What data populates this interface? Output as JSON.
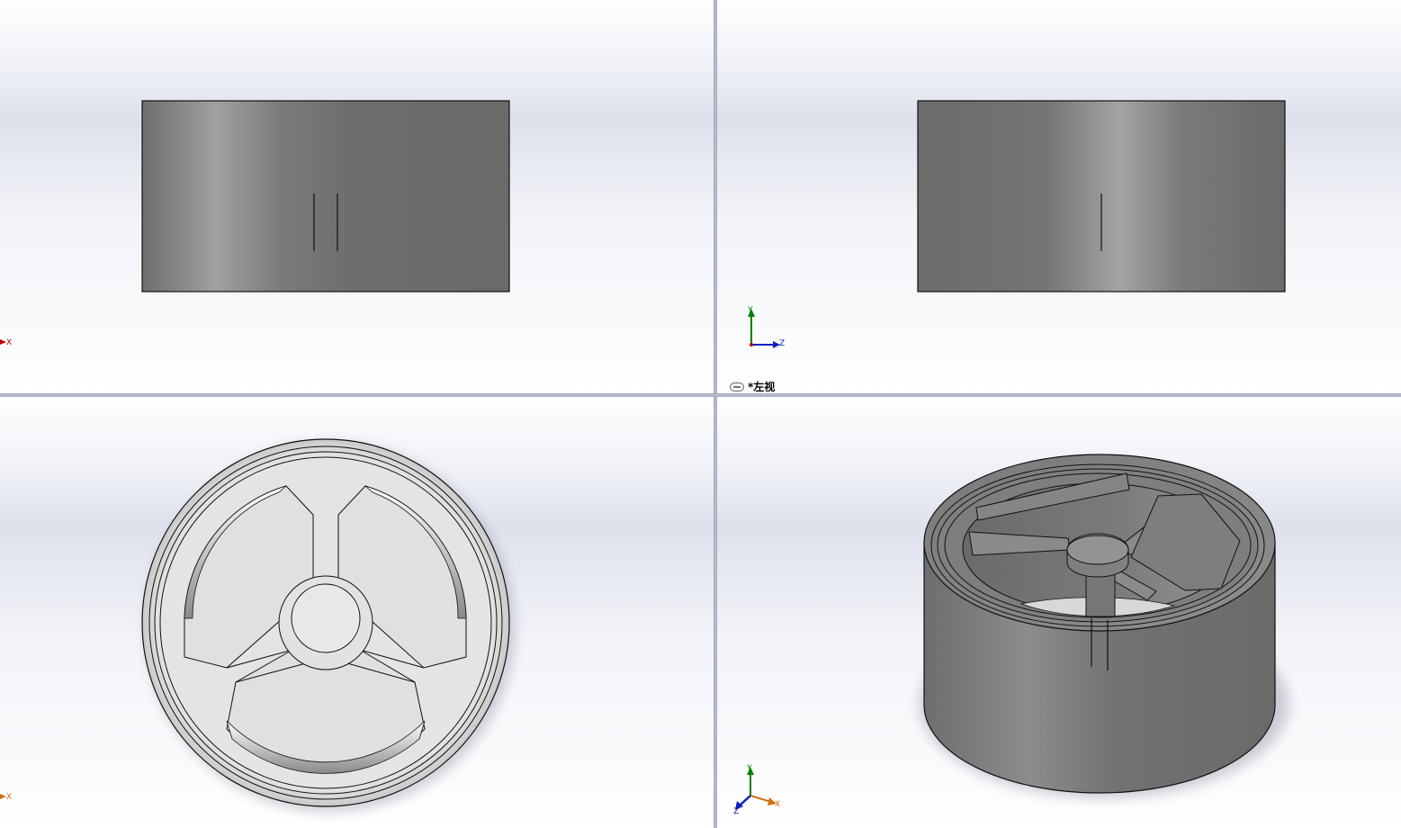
{
  "viewports": {
    "top_left": {
      "label": "",
      "axis": {
        "x": "X"
      }
    },
    "top_right": {
      "label": "*左视",
      "axis": {
        "x": "Z",
        "y": "Y"
      }
    },
    "bottom_left": {
      "label": "",
      "axis": {
        "x": "X"
      }
    },
    "bottom_right": {
      "label": "",
      "axis": {
        "x": "X",
        "y": "Y",
        "z": "Z"
      }
    }
  },
  "colors": {
    "axis_x": "#c00000",
    "axis_y": "#008000",
    "axis_z": "#1020c0",
    "axis_x_iso": "#d07010",
    "part_shade": "#707070",
    "part_highlight": "#a8a8a8",
    "part_light": "#e2e2e2",
    "edge": "#111111"
  },
  "icons": {
    "view_link": "link-icon"
  }
}
